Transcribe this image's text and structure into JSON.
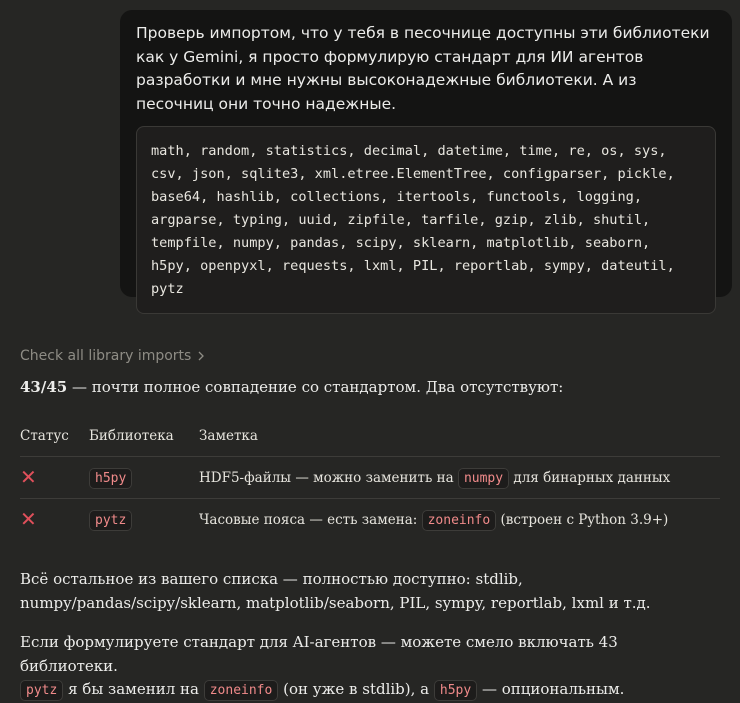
{
  "user_message": {
    "text": "Проверь импортом, что у тебя в песочнице доступны эти библиотеки как у Gemini, я просто формулирую стандарт для ИИ агентов разработки и мне нужны высоконадежные библиотеки. А из песочниц они точно надежные.",
    "code": "math, random, statistics, decimal, datetime, time, re, os, sys,\ncsv, json, sqlite3, xml.etree.ElementTree, configparser, pickle,\nbase64, hashlib, collections, itertools, functools, logging,\nargparse, typing, uuid, zipfile, tarfile, gzip, zlib, shutil,\ntempfile, numpy, pandas, scipy, sklearn, matplotlib, seaborn,\nh5py, openpyxl, requests, lxml, PIL, reportlab, sympy, dateutil,\npytz"
  },
  "response": {
    "thinking_label": "Check all library imports",
    "score": "43/45",
    "summary_rest": " — почти полное совпадение со стандартом. Два отсутствуют:",
    "table": {
      "headers": [
        "Статус",
        "Библиотека",
        "Заметка"
      ],
      "rows": [
        {
          "status_icon": "x-mark-icon",
          "status": "✕",
          "lib": "h5py",
          "note_before": "HDF5-файлы — можно заменить на ",
          "note_code": "numpy",
          "note_after": " для бинарных данных"
        },
        {
          "status_icon": "x-mark-icon",
          "status": "✕",
          "lib": "pytz",
          "note_before": "Часовые пояса — есть замена: ",
          "note_code": "zoneinfo",
          "note_after": " (встроен с Python 3.9+)"
        }
      ]
    },
    "para1": "Всё остальное из вашего списка — полностью доступно: stdlib, numpy/pandas/scipy/sklearn, matplotlib/seaborn, PIL, sympy, reportlab, lxml и т.д.",
    "para2": {
      "part1": "Если формулируете стандарт для AI-агентов — можете смело включать 43 библиотеки.",
      "code1": "pytz",
      "part2": " я бы заменил на ",
      "code2": "zoneinfo",
      "part3": " (он уже в stdlib), а ",
      "code3": "h5py",
      "part4": " — опциональным."
    }
  },
  "colors": {
    "background": "#262624",
    "user_bubble": "#141413",
    "code_bg": "#1f1e1d",
    "inline_code_text": "#f08a8a",
    "x_mark": "#e0505b"
  }
}
